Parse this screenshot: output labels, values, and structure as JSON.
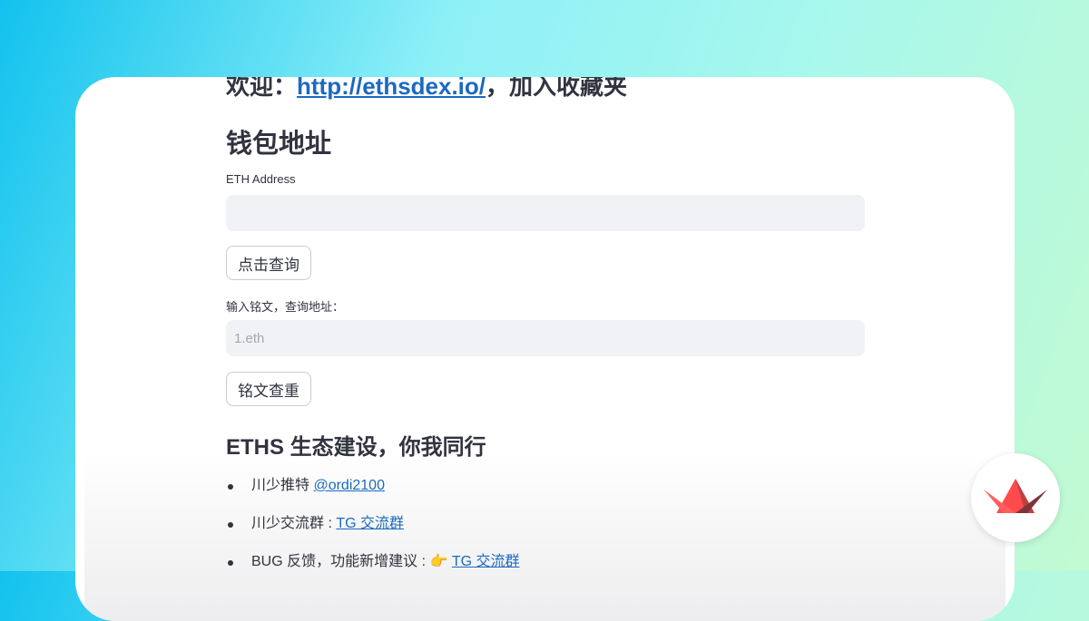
{
  "welcome": {
    "prefix": "欢迎：",
    "link": "http://ethsdex.io/",
    "suffix": "，加入收藏夹"
  },
  "wallet_section": {
    "title": "钱包地址",
    "address_label": "ETH Address",
    "address_value": "",
    "query_button": "点击查询"
  },
  "inscription_section": {
    "label": "输入铭文，查询地址：",
    "placeholder": "1.eth",
    "check_button": "铭文查重"
  },
  "eco_section": {
    "title": "ETHS 生态建设，你我同行",
    "items": [
      {
        "text": "川少推特 ",
        "link": "@ordi2100",
        "emoji": ""
      },
      {
        "text": "川少交流群 : ",
        "link": "TG 交流群",
        "emoji": ""
      },
      {
        "text": "BUG 反馈，功能新增建议 : ",
        "link": "TG 交流群",
        "emoji": "👉 "
      }
    ]
  },
  "badge": {
    "icon": "crown-logo-icon",
    "color": "#ff4b4b"
  }
}
